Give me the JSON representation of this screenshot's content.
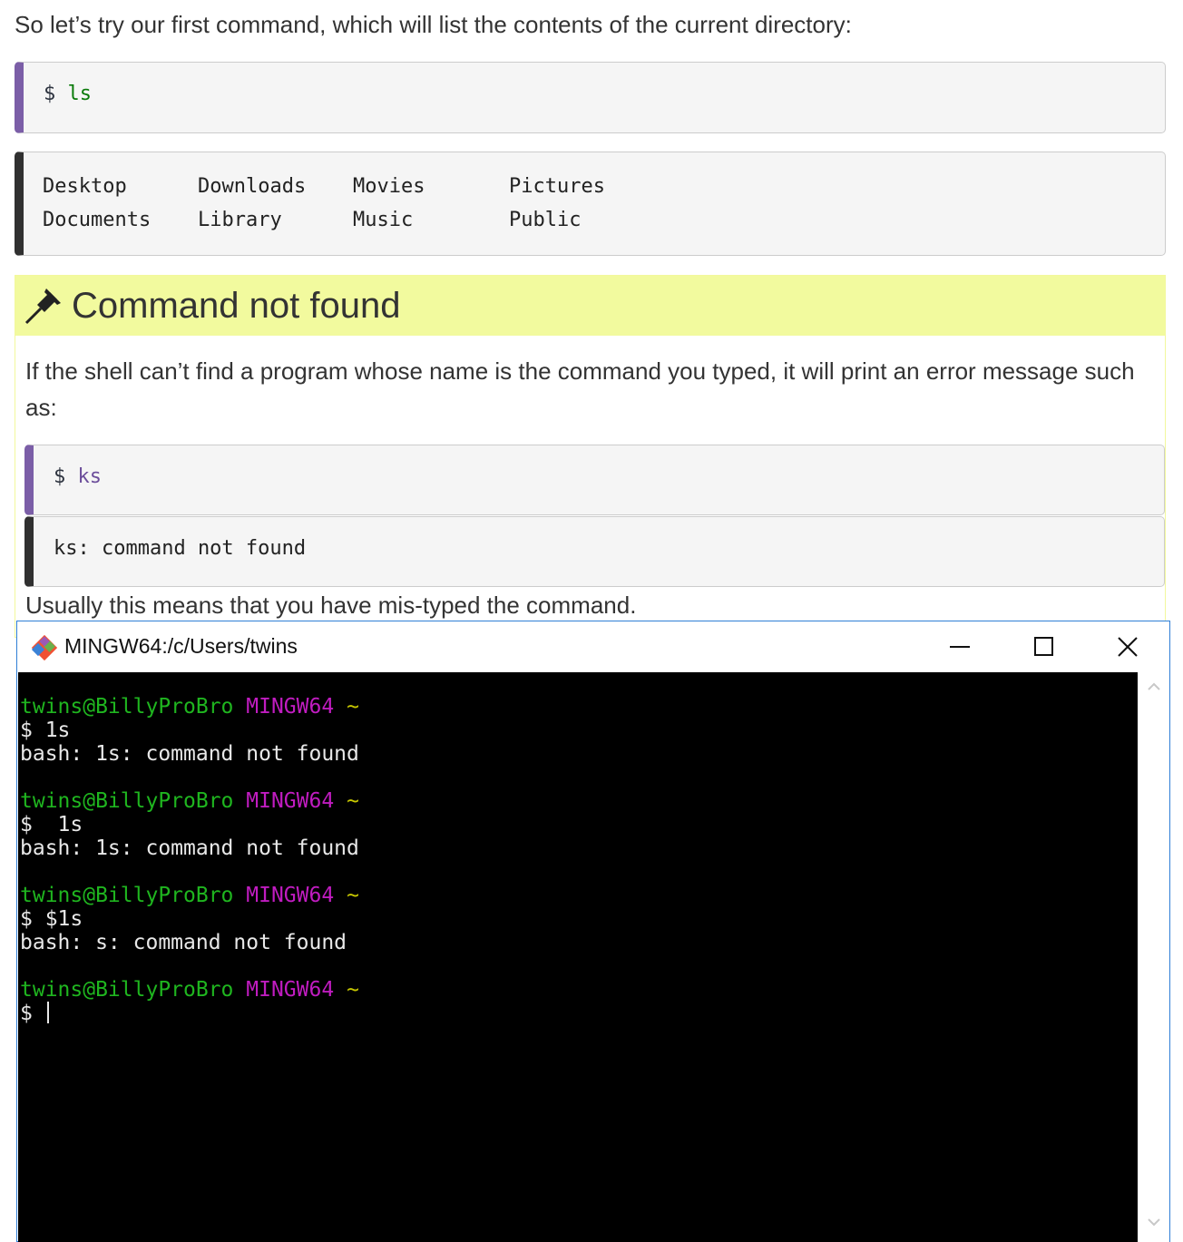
{
  "intro": "So let’s try our first command, which will list the contents of the current directory:",
  "ls_block": {
    "prompt": "$",
    "command": "ls"
  },
  "ls_output": {
    "columns": [
      [
        "Desktop",
        "Documents"
      ],
      [
        "Downloads",
        "Library"
      ],
      [
        "Movies",
        "Music"
      ],
      [
        "Pictures",
        "Public"
      ]
    ]
  },
  "callout": {
    "title": "Command not found",
    "icon": "pushpin-icon",
    "text": "If the shell can’t find a program whose name is the command you typed, it will print an error message such as:",
    "example": {
      "prompt": "$",
      "command": "ks"
    },
    "example_output": "ks: command not found",
    "after": "Usually this means that you have mis-typed the command."
  },
  "terminal": {
    "title": "MINGW64:/c/Users/twins",
    "icon": "git-bash-icon",
    "buttons": [
      "minimize-icon",
      "maximize-icon",
      "close-icon"
    ],
    "sessions": [
      {
        "user": "twins@BillyProBro",
        "env": "MINGW64",
        "dir": "~",
        "input": "$ 1s",
        "output": "bash: 1s: command not found"
      },
      {
        "user": "twins@BillyProBro",
        "env": "MINGW64",
        "dir": "~",
        "input": "$  1s",
        "output": "bash: 1s: command not found"
      },
      {
        "user": "twins@BillyProBro",
        "env": "MINGW64",
        "dir": "~",
        "input": "$ $1s",
        "output": "bash: s: command not found"
      },
      {
        "user": "twins@BillyProBro",
        "env": "MINGW64",
        "dir": "~",
        "input": "$ ",
        "output": ""
      }
    ]
  }
}
